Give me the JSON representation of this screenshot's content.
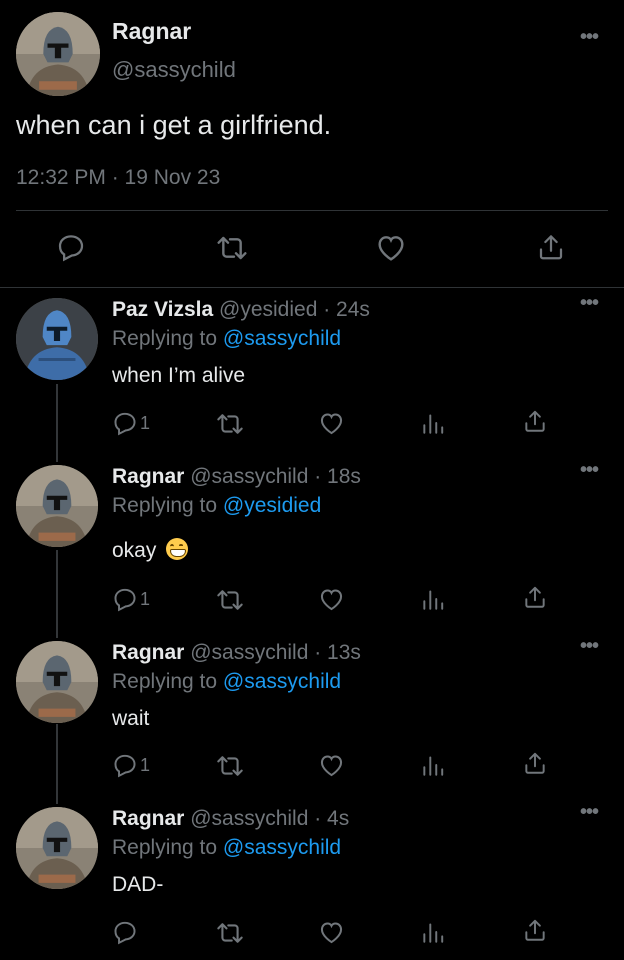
{
  "main_tweet": {
    "name": "Ragnar",
    "handle": "@sassychild",
    "text": "when can i get a girlfriend.",
    "meta": "12:32 PM · 19 Nov 23",
    "more": "•••"
  },
  "replies": [
    {
      "name": "Paz Vizsla",
      "meta": " @yesidied · 24s",
      "replying_prefix": "Replying to ",
      "replying_to": "@sassychild",
      "text": "when I’m alive",
      "reply_count": "1",
      "more": "•••",
      "avatar": "blue-armor"
    },
    {
      "name": "Ragnar",
      "meta": " @sassychild · 18s",
      "replying_prefix": "Replying to ",
      "replying_to": "@yesidied",
      "text": "okay",
      "emoji": "grinning-face-emoji",
      "reply_count": "1",
      "more": "•••",
      "avatar": "grey-armor"
    },
    {
      "name": "Ragnar",
      "meta": " @sassychild · 13s",
      "replying_prefix": "Replying to ",
      "replying_to": "@sassychild",
      "text": "wait",
      "reply_count": "1",
      "more": "•••",
      "avatar": "grey-armor"
    },
    {
      "name": "Ragnar",
      "meta": " @sassychild · 4s",
      "replying_prefix": "Replying to ",
      "replying_to": "@sassychild",
      "text": "DAD-",
      "reply_count": "",
      "more": "•••",
      "avatar": "grey-armor"
    }
  ],
  "icons": [
    "reply-icon",
    "retweet-icon",
    "like-icon",
    "views-icon",
    "share-icon",
    "more-icon"
  ],
  "colors": {
    "background": "#000000",
    "text": "#e7e9ea",
    "secondary": "#71767b",
    "mention": "#1d9bf0",
    "divider": "#2f3336"
  }
}
